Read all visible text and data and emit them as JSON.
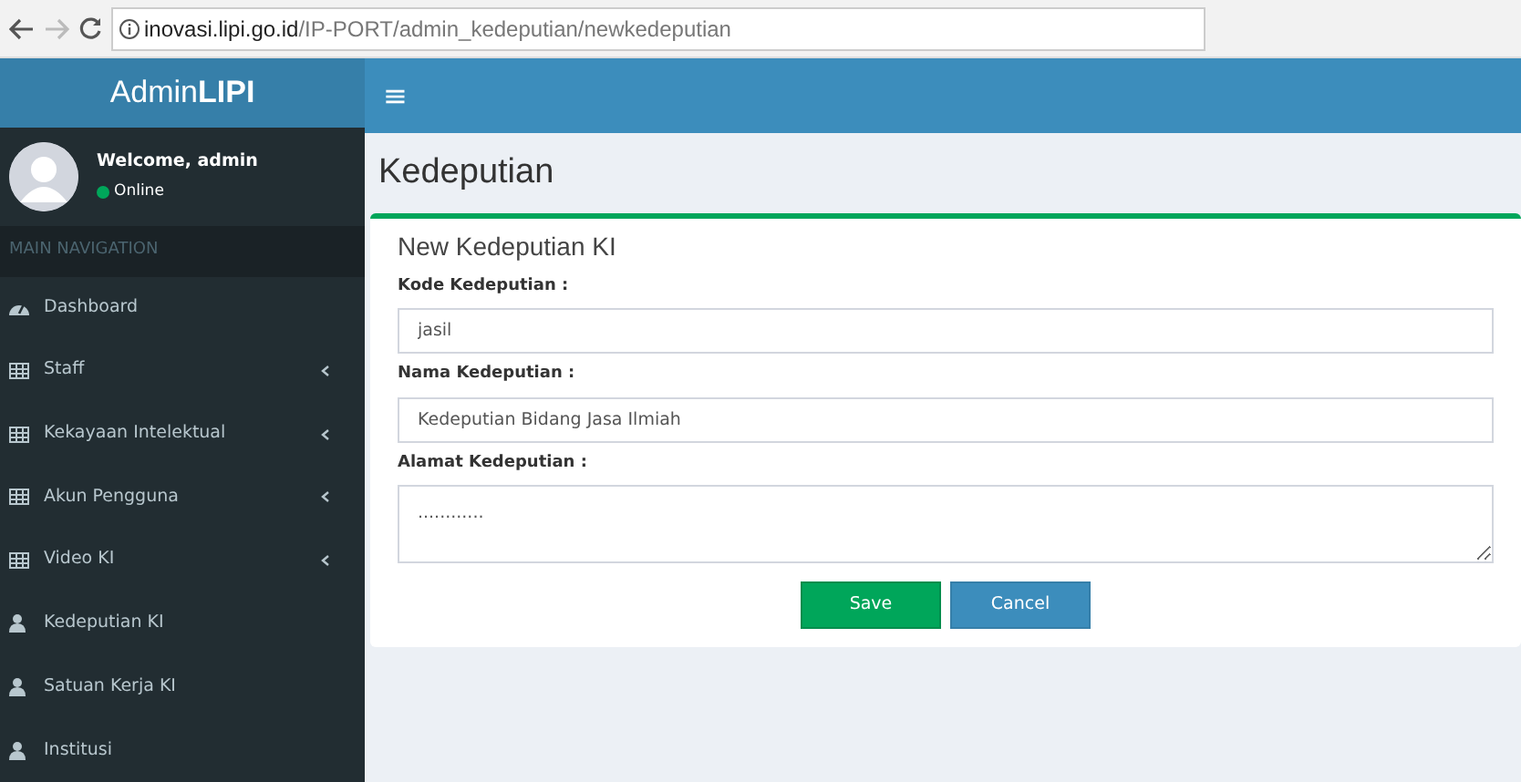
{
  "browser": {
    "url_host": "inovasi.lipi.go.id",
    "url_path": "/IP-PORT/admin_kedeputian/newkedeputian"
  },
  "logo": "Admin**LIPI**",
  "menu_icon": "≡",
  "user": {
    "welcome": "Welcome, admin",
    "status": "Online",
    "online": true
  },
  "sidebar": {
    "header": "MAIN NAVIGATION",
    "items": [
      {
        "label": "Dashboard",
        "kind": "dashboard",
        "expandable": false
      },
      {
        "label": "Staff",
        "kind": "table",
        "expandable": true
      },
      {
        "label": "Kekayaan Intelektual",
        "kind": "table",
        "expandable": true
      },
      {
        "label": "Akun Pengguna",
        "kind": "table",
        "expandable": true
      },
      {
        "label": "Video KI",
        "kind": "table",
        "expandable": true
      },
      {
        "label": "Kedeputian KI",
        "kind": "user",
        "expandable": false
      },
      {
        "label": "Satuan Kerja KI",
        "kind": "user",
        "expandable": false
      },
      {
        "label": "Institusi",
        "kind": "user",
        "expandable": false
      }
    ]
  },
  "page_title": "Kedeputian",
  "form": {
    "title": "New Kedeputian KI",
    "fields": [
      {
        "label": "Kode Kedeputian :",
        "value": "jasil",
        "kind": "input"
      },
      {
        "label": "Nama Kedeputian :",
        "value": "Kedeputian Bidang Jasa Ilmiah",
        "kind": "input"
      },
      {
        "label": "Alamat Kedeputian :",
        "value": "............",
        "kind": "textarea"
      }
    ],
    "buttons": [
      {
        "label": "Save",
        "kind": "success"
      },
      {
        "label": "Cancel",
        "kind": "primary"
      }
    ]
  }
}
